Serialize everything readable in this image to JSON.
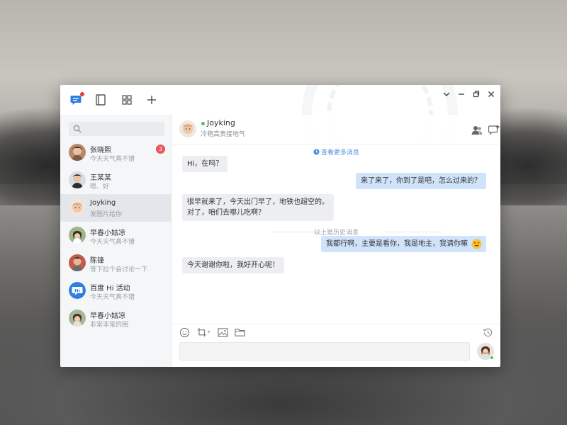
{
  "window_controls": {
    "collapse_icon": "chevron-down-icon",
    "minimize_icon": "minimize-icon",
    "restore_icon": "restore-icon",
    "close_icon": "close-icon"
  },
  "top_nav": {
    "items": [
      {
        "icon": "chat-icon",
        "active": true,
        "has_notification": true
      },
      {
        "icon": "contacts-book-icon"
      },
      {
        "icon": "apps-grid-icon"
      },
      {
        "icon": "plus-icon"
      }
    ],
    "accent_color": "#2f7fe0"
  },
  "search": {
    "placeholder": ""
  },
  "contacts": [
    {
      "name": "张晓熙",
      "last_message": "今天天气真不错",
      "unread": "3"
    },
    {
      "name": "王某某",
      "last_message": "嗯、好",
      "unread": ""
    },
    {
      "name": "Joyking",
      "last_message": "发图片给你",
      "unread": "",
      "active": true
    },
    {
      "name": "早春小姑凉",
      "last_message": "今天天气真不错",
      "unread": ""
    },
    {
      "name": "陈锋",
      "last_message": "等下拉个会讨论一下",
      "unread": ""
    },
    {
      "name": "百度 Hi 活动",
      "last_message": "今天天气真不错",
      "unread": ""
    },
    {
      "name": "早春小姑凉",
      "last_message": "非常非常的困",
      "unread": ""
    }
  ],
  "chat": {
    "name": "Joyking",
    "status": "冷艳高贵接地气",
    "online_color": "#4cc35a",
    "more_history": "查看更多消息",
    "history_divider": "以上是历史消息",
    "messages": [
      {
        "dir": "in",
        "text": "Hi，在吗？"
      },
      {
        "dir": "out",
        "text": "来了来了，你到了是吧，怎么过来的？"
      },
      {
        "dir": "in",
        "line1": "很早就来了，今天出门早了，地铁也超空的。",
        "line2": "对了，咱们去哪儿吃啊？"
      },
      {
        "dir": "out",
        "text": "我都行啊，主要是看你，我是地主，我请你嘛",
        "emoji": "heart-eyes-emoji"
      },
      {
        "dir": "in",
        "text": "今天谢谢你啦，我好开心呢！"
      }
    ]
  },
  "composer": {
    "tools": [
      "emoji-icon",
      "screenshot-icon",
      "image-icon",
      "folder-icon",
      "history-icon"
    ],
    "placeholder": ""
  }
}
